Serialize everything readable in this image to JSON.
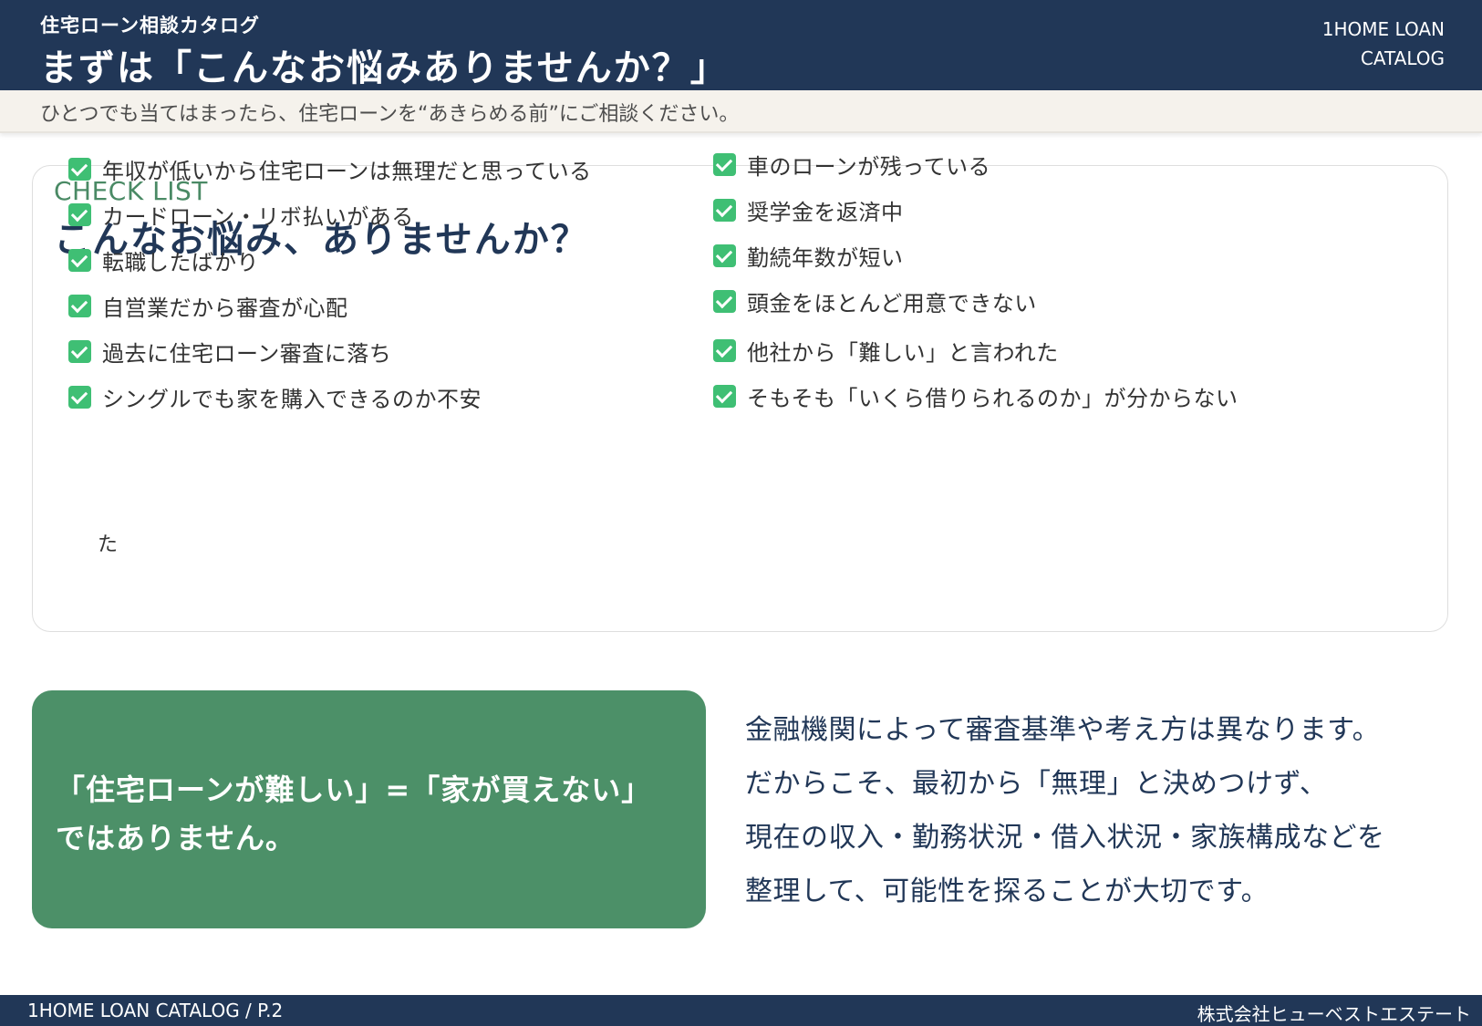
{
  "header": {
    "subtitle": "住宅ローン相談カタログ",
    "title": "まずは「こんなお悩みありませんか？」",
    "brand_line1": "1HOME LOAN",
    "brand_line2": "CATALOG"
  },
  "subbar": {
    "text": "ひとつでも当てはまったら、住宅ローンを“あきらめる前”にご相談ください。"
  },
  "checklist": {
    "kicker": "CHECK LIST",
    "title": "こんなお悩み、ありませんか？",
    "left_items": [
      {
        "label": "年収が低いから住宅ローンは無理だと思っている",
        "checked": true
      },
      {
        "label": "カードローン・リボ払いがある",
        "checked": true
      },
      {
        "label": "転職したばかり",
        "checked": true
      },
      {
        "label": "自営業だから審査が心配",
        "checked": true
      },
      {
        "label": "過去に住宅ローン審査に落ち",
        "checked": true
      },
      {
        "label": "シングルでも家を購入できるのか不安",
        "checked": true
      }
    ],
    "overflow_char": "た",
    "right_items": [
      {
        "label": "車のローンが残っている",
        "checked": true
      },
      {
        "label": "奨学金を返済中",
        "checked": true
      },
      {
        "label": "勤続年数が短い",
        "checked": true
      },
      {
        "label": "頭金をほとんど用意できない",
        "checked": true
      },
      {
        "label": "他社から「難しい」と言われた",
        "checked": true
      },
      {
        "label": "そもそも「いくら借りられるのか」が分からない",
        "checked": true
      }
    ]
  },
  "callout": {
    "line1": "「住宅ローンが難しい」=「家が買えない」",
    "line2": "ではありません。"
  },
  "body": {
    "lines": [
      "金融機関によって審査基準や考え方は異なります。",
      "だからこそ、最初から「無理」と決めつけず、",
      "現在の収入・勤務状況・借入状況・家族構成などを",
      "整理して、可能性を探ることが大切です。"
    ]
  },
  "footer": {
    "left": "1HOME LOAN CATALOG  /  P.2",
    "right": "株式会社ヒューベストエステート"
  },
  "colors": {
    "navy": "#213757",
    "green": "#4c9068",
    "check_green": "#3fbf74",
    "kicker_green": "#4a8a65"
  }
}
